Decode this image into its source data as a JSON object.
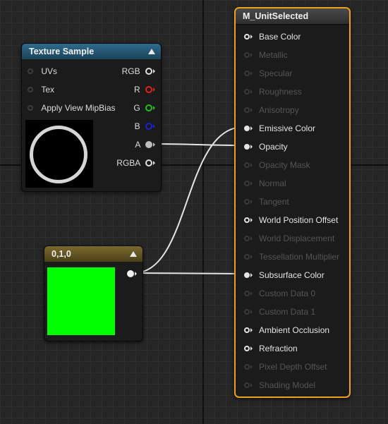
{
  "texture_node": {
    "title": "Texture Sample",
    "inputs": [
      "UVs",
      "Tex",
      "Apply View MipBias"
    ],
    "outputs": [
      {
        "label": "RGB",
        "color": "#e0e0e0"
      },
      {
        "label": "R",
        "color": "#e02020"
      },
      {
        "label": "G",
        "color": "#20c020"
      },
      {
        "label": "B",
        "color": "#2020d0"
      },
      {
        "label": "A",
        "color": "#bdbdbd"
      },
      {
        "label": "RGBA",
        "color": "#e0e0e0"
      }
    ]
  },
  "constant_node": {
    "title": "0,1,0",
    "swatch_color": "#00ff00"
  },
  "material_node": {
    "title": "M_UnitSelected",
    "border_color": "#f0a020",
    "pins": [
      {
        "label": "Base Color",
        "active": true,
        "connected": false
      },
      {
        "label": "Metallic",
        "active": false,
        "connected": false
      },
      {
        "label": "Specular",
        "active": false,
        "connected": false
      },
      {
        "label": "Roughness",
        "active": false,
        "connected": false
      },
      {
        "label": "Anisotropy",
        "active": false,
        "connected": false
      },
      {
        "label": "Emissive Color",
        "active": true,
        "connected": true
      },
      {
        "label": "Opacity",
        "active": true,
        "connected": true
      },
      {
        "label": "Opacity Mask",
        "active": false,
        "connected": false
      },
      {
        "label": "Normal",
        "active": false,
        "connected": false
      },
      {
        "label": "Tangent",
        "active": false,
        "connected": false
      },
      {
        "label": "World Position Offset",
        "active": true,
        "connected": false
      },
      {
        "label": "World Displacement",
        "active": false,
        "connected": false
      },
      {
        "label": "Tessellation Multiplier",
        "active": false,
        "connected": false
      },
      {
        "label": "Subsurface Color",
        "active": true,
        "connected": true
      },
      {
        "label": "Custom Data 0",
        "active": false,
        "connected": false
      },
      {
        "label": "Custom Data 1",
        "active": false,
        "connected": false
      },
      {
        "label": "Ambient Occlusion",
        "active": true,
        "connected": false
      },
      {
        "label": "Refraction",
        "active": true,
        "connected": false
      },
      {
        "label": "Pixel Depth Offset",
        "active": false,
        "connected": false
      },
      {
        "label": "Shading Model",
        "active": false,
        "connected": false
      }
    ]
  }
}
